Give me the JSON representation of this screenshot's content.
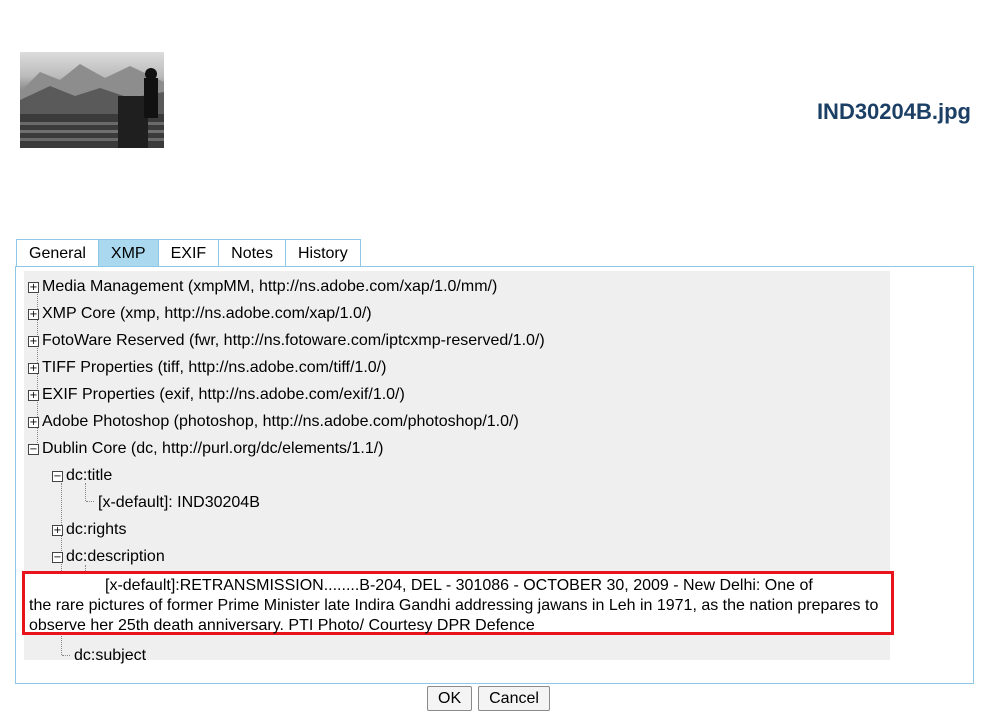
{
  "header": {
    "filename": "IND30204B.jpg"
  },
  "tabs": [
    {
      "label": "General",
      "active": false
    },
    {
      "label": "XMP",
      "active": true
    },
    {
      "label": "EXIF",
      "active": false
    },
    {
      "label": "Notes",
      "active": false
    },
    {
      "label": "History",
      "active": false
    }
  ],
  "tree": {
    "nodes": [
      {
        "label": "Media Management (xmpMM, http://ns.adobe.com/xap/1.0/mm/)",
        "expanded": false
      },
      {
        "label": "XMP Core (xmp, http://ns.adobe.com/xap/1.0/)",
        "expanded": false
      },
      {
        "label": "FotoWare Reserved (fwr, http://ns.fotoware.com/iptcxmp-reserved/1.0/)",
        "expanded": false
      },
      {
        "label": "TIFF Properties (tiff, http://ns.adobe.com/tiff/1.0/)",
        "expanded": false
      },
      {
        "label": "EXIF Properties (exif, http://ns.adobe.com/exif/1.0/)",
        "expanded": false
      },
      {
        "label": "Adobe Photoshop (photoshop, http://ns.adobe.com/photoshop/1.0/)",
        "expanded": false
      },
      {
        "label": "Dublin Core (dc, http://purl.org/dc/elements/1.1/)",
        "expanded": true
      }
    ],
    "dc": {
      "title": "dc:title",
      "title_value": "[x-default]: IND30204B",
      "rights": "dc:rights",
      "description": "dc:description",
      "description_value_first": "[x-default]:RETRANSMISSION........B-204, DEL - 301086 - OCTOBER 30, 2009 - New Delhi: One of",
      "description_value_rest": "the rare pictures of former Prime Minister late Indira Gandhi addressing jawans in Leh in 1971, as the nation prepares to observe her 25th death anniversary. PTI Photo/ Courtesy DPR Defence",
      "subject": "dc:subject"
    },
    "plus_glyph": "+",
    "minus_glyph": "−"
  },
  "buttons": {
    "ok": "OK",
    "cancel": "Cancel"
  },
  "colors": {
    "accent_border": "#8fc8e6",
    "active_tab": "#a9d8ef",
    "highlight": "#e8141c",
    "filename": "#1c3f66"
  }
}
